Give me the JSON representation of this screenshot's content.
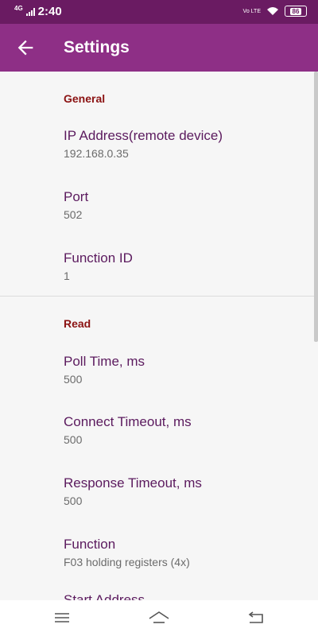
{
  "status": {
    "network": "4G",
    "time": "2:40",
    "volte": "Vo LTE",
    "battery": "86"
  },
  "appbar": {
    "title": "Settings"
  },
  "sections": [
    {
      "header": "General",
      "items": [
        {
          "title": "IP Address(remote device)",
          "summary": "192.168.0.35"
        },
        {
          "title": "Port",
          "summary": "502"
        },
        {
          "title": "Function ID",
          "summary": "1"
        }
      ]
    },
    {
      "header": "Read",
      "items": [
        {
          "title": "Poll Time, ms",
          "summary": "500"
        },
        {
          "title": "Connect Timeout, ms",
          "summary": "500"
        },
        {
          "title": "Response Timeout, ms",
          "summary": "500"
        },
        {
          "title": "Function",
          "summary": "F03 holding registers (4x)"
        },
        {
          "title": "Start Address",
          "summary": ""
        }
      ]
    }
  ],
  "navbar": {
    "icons": [
      "menu-icon",
      "home-icon",
      "back-icon"
    ]
  },
  "colors": {
    "statusbar": "#6a1b62",
    "appbar": "#8e2f86",
    "category": "#8b1212",
    "pref_title": "#5b1a5e"
  }
}
